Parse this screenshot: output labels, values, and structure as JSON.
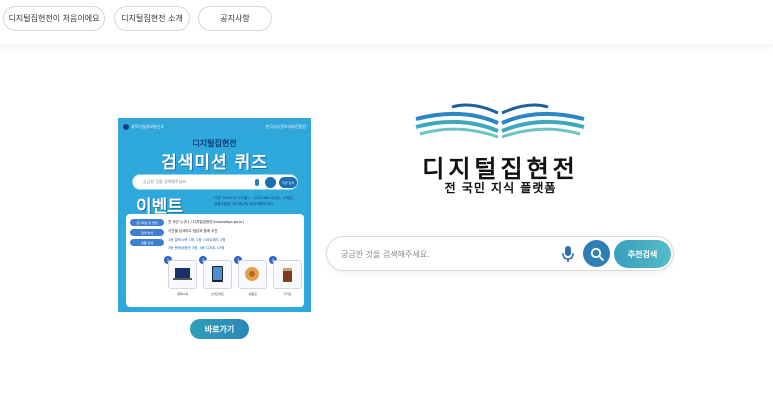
{
  "nav": {
    "items": [
      {
        "label": "디지털집현전이 처음이에요"
      },
      {
        "label": "디지털집현전 소개"
      },
      {
        "label": "공지사항"
      }
    ]
  },
  "banner": {
    "org_left": "과학기술정보통신부",
    "org_right": "한국지능정보사회진흥원",
    "subtitle": "디지털집현전",
    "title": "검색미션 퀴즈",
    "search_placeholder": "궁금한 것을 검색해주세요.",
    "search_recommend": "추천 검색",
    "event_word": "이벤트",
    "period_lines": [
      "기간: 2024.07.22(월) ~ 2024.08.02(금), 12일간",
      "당첨자발표: 02.08(목) 공지사항에 게시"
    ],
    "tags": [
      "참가대상 및 방법",
      "참여 방식",
      "경품 상세"
    ],
    "lines": [
      "전 국민 누구나 / 디지털집현전(knowledge.go.kr)",
      "기관별 검색하고 정답과 함께 추천",
      "1등 갤럭시북 1명, 2등 스마트패드 2명",
      "3등 문화상품권 3명, 4등 디저트 10명"
    ],
    "prizes": [
      {
        "num": "1",
        "caption": "갤럭시북"
      },
      {
        "num": "2",
        "caption": "스마트패드"
      },
      {
        "num": "3",
        "caption": "상품권"
      },
      {
        "num": "4",
        "caption": "디저트"
      }
    ],
    "go_label": "바로가기"
  },
  "brand": {
    "title": "디지털집현전",
    "subtitle": "전 국민 지식 플랫폼",
    "colors": {
      "teal": "#2e9fb8",
      "navy": "#1f4f8a"
    }
  },
  "search": {
    "placeholder": "궁금한 것을 검색해주세요.",
    "value": "",
    "mic_icon": "microphone-icon",
    "search_icon": "search-icon",
    "recommend_label": "추천검색"
  }
}
